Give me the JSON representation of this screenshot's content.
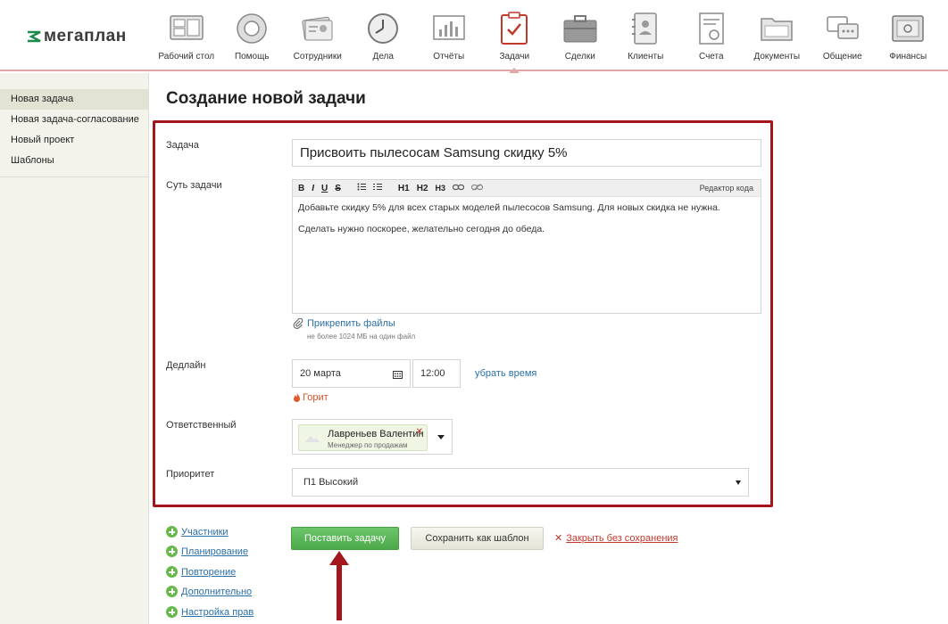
{
  "brand": {
    "name": "мегаплан",
    "color": "#1f8a4c"
  },
  "nav": [
    {
      "label": "Рабочий стол",
      "icon": "desktop-icon"
    },
    {
      "label": "Помощь",
      "icon": "lifebuoy-icon"
    },
    {
      "label": "Сотрудники",
      "icon": "employees-icon"
    },
    {
      "label": "Дела",
      "icon": "clock-icon"
    },
    {
      "label": "Отчёты",
      "icon": "reports-icon"
    },
    {
      "label": "Задачи",
      "icon": "tasks-icon",
      "active": true
    },
    {
      "label": "Сделки",
      "icon": "briefcase-icon"
    },
    {
      "label": "Клиенты",
      "icon": "clients-icon"
    },
    {
      "label": "Счета",
      "icon": "invoices-icon"
    },
    {
      "label": "Документы",
      "icon": "documents-icon"
    },
    {
      "label": "Общение",
      "icon": "chat-icon"
    },
    {
      "label": "Финансы",
      "icon": "safe-icon"
    }
  ],
  "sidebar": {
    "items": [
      {
        "label": "Новая задача",
        "active": true
      },
      {
        "label": "Новая задача-согласование"
      },
      {
        "label": "Новый проект"
      },
      {
        "label": "Шаблоны"
      }
    ]
  },
  "page": {
    "title": "Создание новой задачи"
  },
  "form": {
    "task_label": "Задача",
    "task_value": "Присвоить пылесосам Samsung скидку 5%",
    "essence_label": "Суть задачи",
    "toolbar": {
      "bold": "B",
      "italic": "I",
      "underline": "U",
      "strike": "S",
      "h1": "H1",
      "h2": "H2",
      "h3": "H3",
      "code_editor": "Редактор кода"
    },
    "essence_lines": [
      "Добавьте скидку 5% для всех старых моделей пылесосов Samsung. Для новых скидка не нужна.",
      "Сделать нужно поскорее, желательно сегодня до обеда."
    ],
    "attach_label": "Прикрепить файлы",
    "attach_hint": "не более 1024 МБ на один файл",
    "deadline_label": "Дедлайн",
    "deadline_date": "20 марта",
    "deadline_time": "12:00",
    "remove_time": "убрать время",
    "urgent": "Горит",
    "responsible_label": "Ответственный",
    "responsible_name": "Лавреньев Валентин",
    "responsible_role": "Менеджер по продажам",
    "priority_label": "Приоритет",
    "priority_value": "П1 Высокий"
  },
  "extras": [
    "Участники",
    "Планирование",
    "Повторение",
    "Дополнительно",
    "Настройка прав"
  ],
  "actions": {
    "submit": "Поставить задачу",
    "save_template": "Сохранить как шаблон",
    "close": "Закрыть без сохранения"
  },
  "colors": {
    "accent_red": "#a3161c",
    "link_blue": "#2b6fa5",
    "primary_green": "#5cb85c"
  }
}
